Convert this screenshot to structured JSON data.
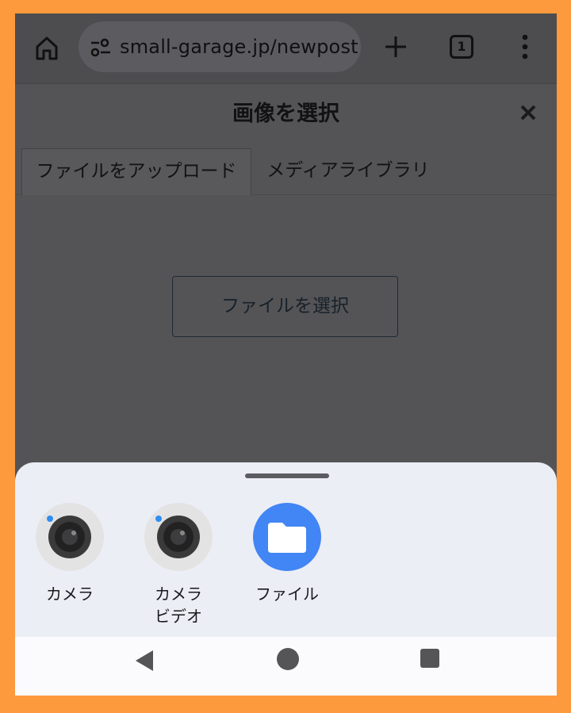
{
  "browser": {
    "url": "small-garage.jp/newpost",
    "tab_count": "1",
    "icons": [
      "home-icon",
      "site-settings-icon",
      "plus-icon",
      "tabs-icon",
      "more-vert-icon"
    ]
  },
  "modal": {
    "title": "画像を選択",
    "close_icon": "close-icon",
    "tabs": [
      {
        "label": "ファイルをアップロード",
        "selected": true
      },
      {
        "label": "メディアライブラリ",
        "selected": false
      }
    ],
    "choose_button": "ファイルを選択"
  },
  "sheet": {
    "apps": [
      {
        "label": "カメラ",
        "icon": "camera-icon"
      },
      {
        "label": "カメラ\nビデオ",
        "icon": "video-camera-icon"
      },
      {
        "label": "ファイル",
        "icon": "folder-icon"
      }
    ]
  },
  "navbar": {
    "icons": [
      "back-icon",
      "home-circle-icon",
      "recents-icon"
    ]
  },
  "colors": {
    "frame": "#fe9a3e",
    "overlay": "#545456",
    "sheet": "#eceef6",
    "files_blue": "#4285f4"
  }
}
